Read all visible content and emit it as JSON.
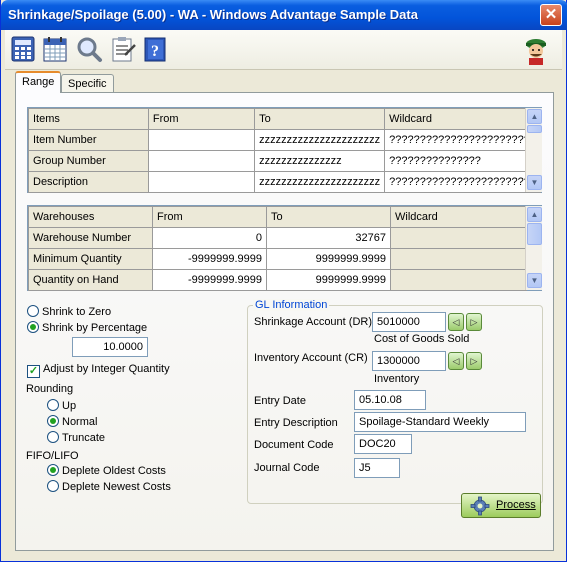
{
  "window": {
    "title": "Shrinkage/Spoilage (5.00) - WA - Windows Advantage Sample Data",
    "close_glyph": "✕"
  },
  "toolbar": {
    "icons": [
      "calculator-icon",
      "calendar-icon",
      "magnifier-icon",
      "checklist-icon",
      "help-book-icon",
      "mascot-icon"
    ]
  },
  "tabs": [
    {
      "label": "Range",
      "active": true
    },
    {
      "label": "Specific",
      "active": false
    }
  ],
  "items_grid": {
    "headers": [
      "Items",
      "From",
      "To",
      "Wildcard"
    ],
    "rows": [
      {
        "label": "Item Number",
        "from": "",
        "to": "zzzzzzzzzzzzzzzzzzzzzz",
        "wildcard": "????????????????????????"
      },
      {
        "label": "Group Number",
        "from": "",
        "to": "zzzzzzzzzzzzzzz",
        "wildcard": "???????????????"
      },
      {
        "label": "Description",
        "from": "",
        "to": "zzzzzzzzzzzzzzzzzzzzzz",
        "wildcard": "????????????????????????"
      }
    ]
  },
  "warehouses_grid": {
    "headers": [
      "Warehouses",
      "From",
      "To",
      "Wildcard"
    ],
    "rows": [
      {
        "label": "Warehouse Number",
        "from": "0",
        "to": "32767",
        "wildcard": ""
      },
      {
        "label": "Minimum Quantity",
        "from": "-9999999.9999",
        "to": "9999999.9999",
        "wildcard": ""
      },
      {
        "label": "Quantity on Hand",
        "from": "-9999999.9999",
        "to": "9999999.9999",
        "wildcard": ""
      }
    ]
  },
  "options": {
    "shrink_to_zero": "Shrink to Zero",
    "shrink_by_percentage": "Shrink by Percentage",
    "selected_mode": "Shrink by Percentage",
    "percentage": "10.0000",
    "adjust_integer": "Adjust by Integer Quantity",
    "adjust_integer_checked": true,
    "checkmark": "✓",
    "rounding_title": "Rounding",
    "rounding": [
      "Up",
      "Normal",
      "Truncate"
    ],
    "rounding_selected": "Normal",
    "fifo_title": "FIFO/LIFO",
    "fifo": [
      "Deplete Oldest Costs",
      "Deplete Newest Costs"
    ],
    "fifo_selected": "Deplete Oldest Costs"
  },
  "gl": {
    "title": "GL Information",
    "shrinkage_label": "Shrinkage Account (DR)",
    "shrinkage_value": "5010000",
    "shrinkage_desc": "Cost of Goods Sold",
    "inventory_label": "Inventory Account (CR)",
    "inventory_value": "1300000",
    "inventory_desc": "Inventory",
    "entry_date_label": "Entry Date",
    "entry_date_value": "05.10.08",
    "entry_desc_label": "Entry Description",
    "entry_desc_value": "Spoilage-Standard Weekly",
    "doc_code_label": "Document Code",
    "doc_code_value": "DOC20",
    "journal_label": "Journal Code",
    "journal_value": "J5",
    "prev_glyph": "◁",
    "next_glyph": "▷"
  },
  "scroll": {
    "up_glyph": "▲",
    "down_glyph": "▼"
  },
  "process_label": "Process"
}
